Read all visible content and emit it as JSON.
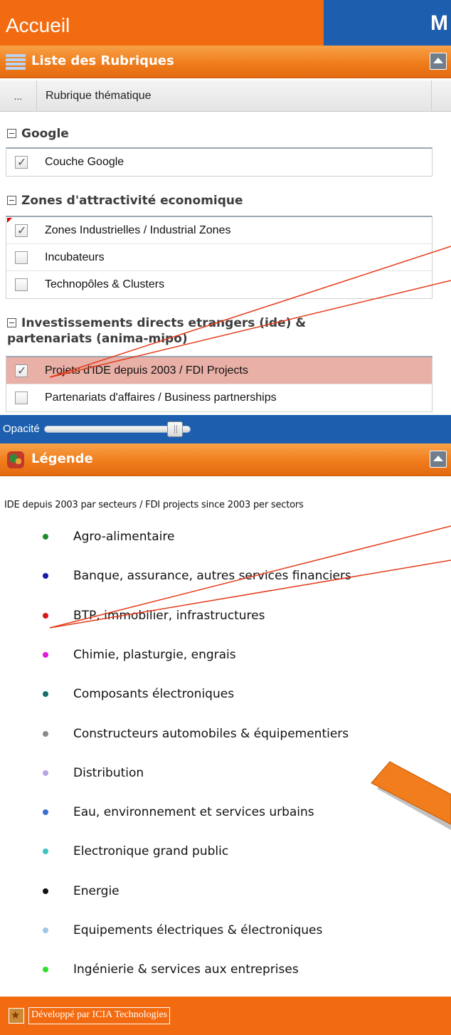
{
  "topbar": {
    "home_tab": "Accueil",
    "right_tab": "M"
  },
  "rubriques": {
    "title": "Liste des Rubriques",
    "column_prefix": "...",
    "column_name": "Rubrique thématique"
  },
  "groups": [
    {
      "title": "Google",
      "layers": [
        {
          "label": "Couche Google",
          "checked": true
        }
      ]
    },
    {
      "title": "Zones d'attractivité economique",
      "layers": [
        {
          "label": "Zones Industrielles / Industrial Zones",
          "checked": true
        },
        {
          "label": "Incubateurs",
          "checked": false
        },
        {
          "label": "Technopôles & Clusters",
          "checked": false
        }
      ]
    },
    {
      "title_line1": "Investissements directs etrangers (ide) &",
      "title_line2": "partenariats (anima-mipo)",
      "layers": [
        {
          "label": "Projets d'IDE depuis 2003 / FDI Projects",
          "checked": true,
          "selected": true
        },
        {
          "label": "Partenariats d'affaires / Business partnerships",
          "checked": false
        }
      ]
    }
  ],
  "opacity": {
    "label": "Opacité",
    "level": 0.92
  },
  "legend": {
    "title": "Légende",
    "caption": "IDE depuis 2003 par secteurs / FDI projects since 2003 per sectors",
    "items": [
      {
        "label": "Agro-alimentaire",
        "color": "#1e8a2e"
      },
      {
        "label": "Banque, assurance, autres services financiers",
        "color": "#1a1aa8"
      },
      {
        "label": "BTP, immobilier, infrastructures",
        "color": "#d81818"
      },
      {
        "label": "Chimie, plasturgie, engrais",
        "color": "#e21ad6"
      },
      {
        "label": "Composants électroniques",
        "color": "#16706a"
      },
      {
        "label": "Constructeurs automobiles & équipementiers",
        "color": "#8a8a8a"
      },
      {
        "label": "Distribution",
        "color": "#b9a6e6"
      },
      {
        "label": "Eau, environnement et services urbains",
        "color": "#3b6fd4"
      },
      {
        "label": "Electronique grand public",
        "color": "#3ec4c4"
      },
      {
        "label": "Energie",
        "color": "#111111"
      },
      {
        "label": "Equipements électriques & électroniques",
        "color": "#9cc8ee"
      },
      {
        "label": "Ingénierie & services aux entreprises",
        "color": "#2ee02e"
      }
    ]
  },
  "footer": {
    "text": "Développé par ICIA Technologies"
  }
}
